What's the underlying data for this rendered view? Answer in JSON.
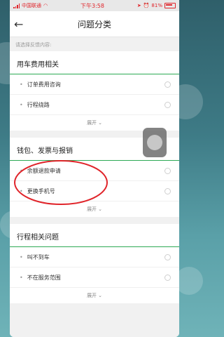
{
  "status_bar": {
    "carrier": "中国联通",
    "time": "下午3:58",
    "battery": "81%"
  },
  "header": {
    "title": "问题分类",
    "back_icon": "back-arrow-icon"
  },
  "hint": "请选择反馈内容:",
  "sections": [
    {
      "title": "用车费用相关",
      "items": [
        {
          "label": "订单费用咨询"
        },
        {
          "label": "行程绕路"
        }
      ],
      "expand_label": "展开"
    },
    {
      "title": "钱包、发票与报销",
      "items": [
        {
          "label": "余额退款申请"
        },
        {
          "label": "更换手机号"
        }
      ],
      "expand_label": "展开"
    },
    {
      "title": "行程相关问题",
      "items": [
        {
          "label": "叫不到车"
        },
        {
          "label": "不在服务范围"
        }
      ],
      "expand_label": "展开"
    }
  ],
  "colors": {
    "accent_green": "#2daa55",
    "annotation_red": "#e0242a"
  }
}
